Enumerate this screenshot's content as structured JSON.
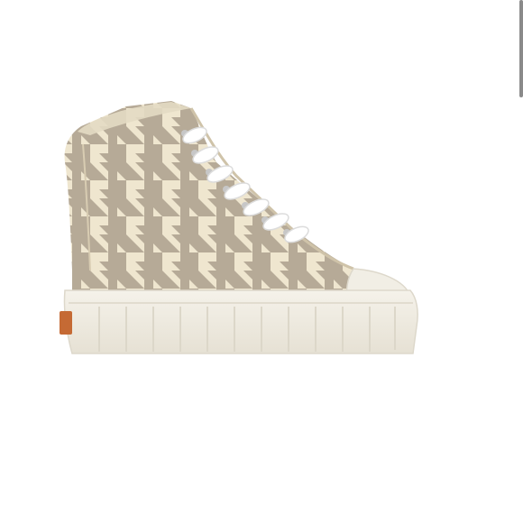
{
  "product_image": {
    "subject": "houndstooth-high-top-sneaker",
    "colors": {
      "background": "#ffffff",
      "canvas_light": "#efe6cf",
      "houndstooth": "#b6aa97",
      "sole": "#f2efe6",
      "sole_shadow": "#d9d4c6",
      "laces": "#ffffff",
      "heel_tab": "#c56a34",
      "eyelets": "#c7c7c7"
    }
  }
}
